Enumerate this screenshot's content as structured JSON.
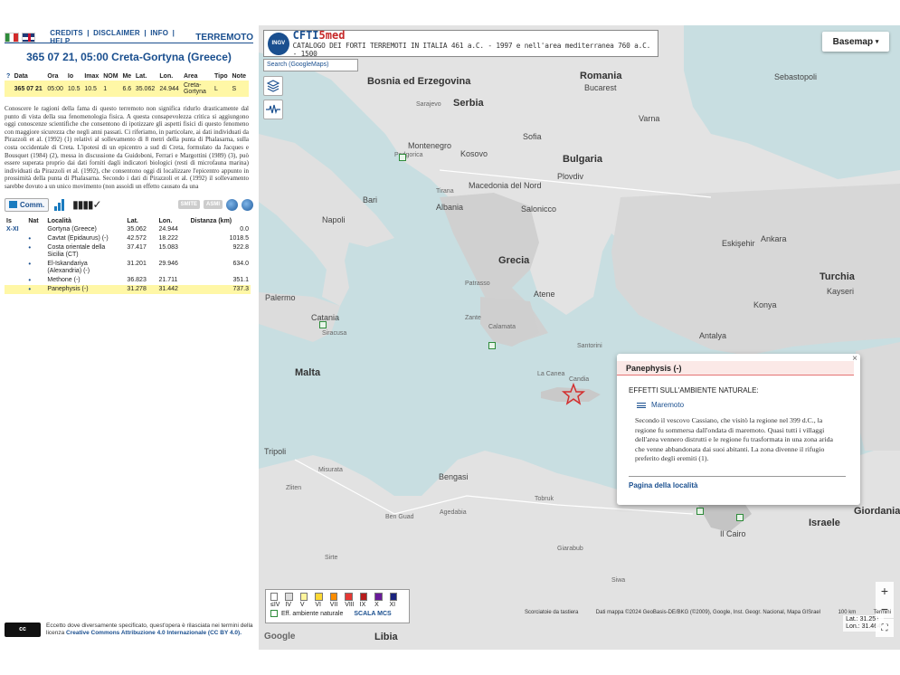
{
  "header": {
    "links": [
      "CREDITS",
      "DISCLAIMER",
      "INFO",
      "HELP"
    ],
    "separator": "|",
    "brand": "TERREMOTO"
  },
  "event": {
    "title": "365 07 21, 05:00 Creta-Gortyna (Greece)",
    "columns": [
      "?",
      "Data",
      "Ora",
      "Io",
      "Imax",
      "NOM",
      "Me",
      "Lat.",
      "Lon.",
      "Area",
      "Tipo",
      "Note"
    ],
    "row": [
      "",
      "365 07 21",
      "05:00",
      "10.5",
      "10.5",
      "1",
      "6.6",
      "35.062",
      "24.944",
      "Creta-Gortyna",
      "L",
      "S"
    ]
  },
  "description": "Conoscere le ragioni della fama di questo terremoto non significa ridurlo drasticamente dal punto di vista della sua fenomenologia fisica. A questa consapevolezza critica si aggiungono oggi conoscenze scientifiche che consentono di ipotizzare gli aspetti fisici di questo fenomeno con maggiore sicurezza che negli anni passati. Ci riferiamo, in particolare, ai dati individuati da Pirazzoli et al. (1992) (1) relativi al sollevamento di 8 metri della punta di Phalasarna, sulla costa occidentale di Creta. L'ipotesi di un epicentro a sud di Creta, formulato da Jacques e Bousquet (1984) (2), messa in discussione da Guidoboni, Ferrari e Margottini (1989) (3), può essere superata proprio dai dati forniti dagli indicatori biologici (resti di microfauna marina) individuati da Pirazzoli et al. (1992), che consentono oggi di localizzare l'epicentro appunto in prossimità della punta di Phalasarna. Secondo i dati di Pirazzoli et al. (1992) il sollevamento sarebbe dovuto a un unico movimento (non assoidi un effetto causato da una",
  "tools": {
    "comm_label": "Comm.",
    "logos": [
      "SMITE",
      "ASMI"
    ]
  },
  "localities": {
    "columns": [
      "Is",
      "Nat",
      "Località",
      "Lat.",
      "Lon.",
      "Distanza (km)"
    ],
    "rows": [
      {
        "is": "X-XI",
        "nat": "",
        "name": "Gortyna (Greece)",
        "lat": "35.062",
        "lon": "24.944",
        "dist": "0.0"
      },
      {
        "is": "",
        "nat": "•",
        "name": "Cavtat (Epidaurus) (-)",
        "lat": "42.572",
        "lon": "18.222",
        "dist": "1018.5"
      },
      {
        "is": "",
        "nat": "•",
        "name": "Costa orientale della Sicilia (CT)",
        "lat": "37.417",
        "lon": "15.083",
        "dist": "922.8"
      },
      {
        "is": "",
        "nat": "•",
        "name": "El-Iskandariya (Alexandria) (-)",
        "lat": "31.201",
        "lon": "29.946",
        "dist": "634.0"
      },
      {
        "is": "",
        "nat": "•",
        "name": "Methone (-)",
        "lat": "36.823",
        "lon": "21.711",
        "dist": "351.1"
      },
      {
        "is": "",
        "nat": "•",
        "name": "Panephysis (-)",
        "lat": "31.278",
        "lon": "31.442",
        "dist": "737.3"
      }
    ]
  },
  "license": {
    "badge": "cc",
    "text": "Eccetto dove diversamente specificato, quest'opera è rilasciata nei termini della licenza",
    "link": "Creative Commons Attribuzione 4.0 Internazionale (CC BY 4.0)."
  },
  "map": {
    "title_a": "CFTI",
    "title_b": "5med",
    "subtitle": "CATALOGO DEI FORTI TERREMOTI IN ITALIA 461 a.C. - 1997 e nell'area mediterranea 760 a.C. - 1500",
    "ingv": "INGV",
    "search": "Search (GoogleMaps)",
    "basemap": "Basemap",
    "labels": [
      "Bosnia ed Erzegovina",
      "Serbia",
      "Romania",
      "Bucarest",
      "Montenegro",
      "Kosovo",
      "Bulgaria",
      "Macedonia del Nord",
      "Albania",
      "Grecia",
      "Atene",
      "Turchia",
      "Ankara",
      "Konya",
      "Kayseri",
      "Malta",
      "Libia",
      "Tripoli",
      "Bengasi",
      "Il Cairo",
      "Israele",
      "Giordania",
      "Eskişehir",
      "Bari",
      "Napoli",
      "Palermo",
      "Catania",
      "Siracusa",
      "Salonicco",
      "Sofia",
      "Varna",
      "Podgorica",
      "Sarajevo",
      "Tirana",
      "Patrasso",
      "Zante",
      "Calamata",
      "La Canea",
      "Candia",
      "Santorini",
      "Sebastopoli",
      "Plovdiv",
      "Antalya",
      "Misurata",
      "Zliten",
      "Sirte",
      "Ben Guad",
      "Agedabia",
      "Tobruk",
      "Giarabub",
      "Siwa"
    ],
    "popup": {
      "title": "Panephysis (-)",
      "section": "EFFETTI SULL'AMBIENTE NATURALE:",
      "effect": "Maremoto",
      "text": "Secondo il vescovo Cassiano, che visitò la regione nel 399 d.C., la regione fu sommersa dall'ondata di maremoto. Quasi tutti i villaggi dell'area vennero distrutti e le regione fu trasformata in una zona arida che venne abbandonata dai suoi abitanti. La zona divenne il rifugio preferito degli eremiti (1).",
      "link": "Pagina della località"
    },
    "legend": {
      "intensity_labels": [
        "≤IV",
        "IV",
        "V",
        "VI",
        "VII",
        "VIII",
        "IX",
        "X",
        "XI"
      ],
      "intensity_colors": [
        "#ffffff",
        "#dddddd",
        "#fff59d",
        "#fdd835",
        "#fb8c00",
        "#e53935",
        "#b71c1c",
        "#6a1b9a",
        "#1a237e"
      ],
      "effects_label": "Eff. ambiente naturale",
      "scale_link": "SCALA MCS"
    },
    "attribution": [
      "Scorciatoie da tastiera",
      "Dati mappa ©2024 GeoBasis-DE/BKG (©2009), Google, Inst. Geogr. Nacional, Mapa GISrael",
      "100 km",
      "Termini"
    ],
    "lat": "Lat.: 31.251",
    "lon": "Lon.: 31.464",
    "zoom_in": "+",
    "zoom_out": "−",
    "google": "Google"
  }
}
